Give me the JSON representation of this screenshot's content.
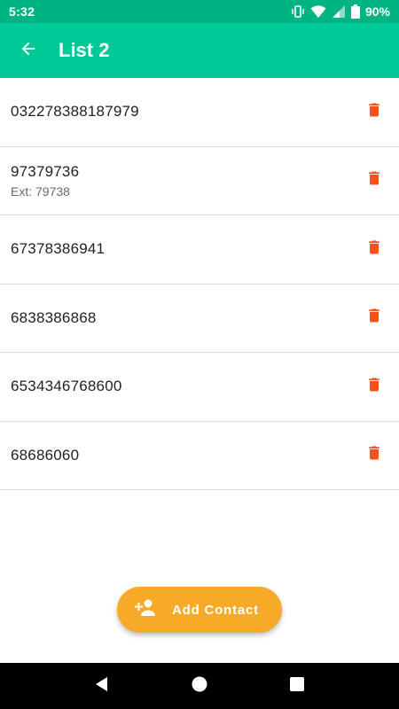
{
  "status_bar": {
    "time": "5:32",
    "battery": "90%",
    "icons": [
      "vibrate-icon",
      "wifi-icon",
      "signal-icon",
      "battery-icon"
    ]
  },
  "app_bar": {
    "title": "List 2",
    "back_icon": "arrow-back-icon",
    "background": "#00C896"
  },
  "contacts": [
    {
      "phone": "032278388187979",
      "ext": ""
    },
    {
      "phone": "97379736",
      "ext": "Ext: 79738"
    },
    {
      "phone": "67378386941",
      "ext": ""
    },
    {
      "phone": "6838386868",
      "ext": ""
    },
    {
      "phone": "6534346768600",
      "ext": ""
    },
    {
      "phone": "68686060",
      "ext": ""
    }
  ],
  "delete_icon": "trash-icon",
  "delete_color": "#F4511E",
  "fab": {
    "label": "Add Contact",
    "icon": "person-add-icon",
    "color": "#F7A928"
  },
  "nav_bar": {
    "icons": [
      "back-triangle-icon",
      "home-circle-icon",
      "recents-square-icon"
    ]
  }
}
